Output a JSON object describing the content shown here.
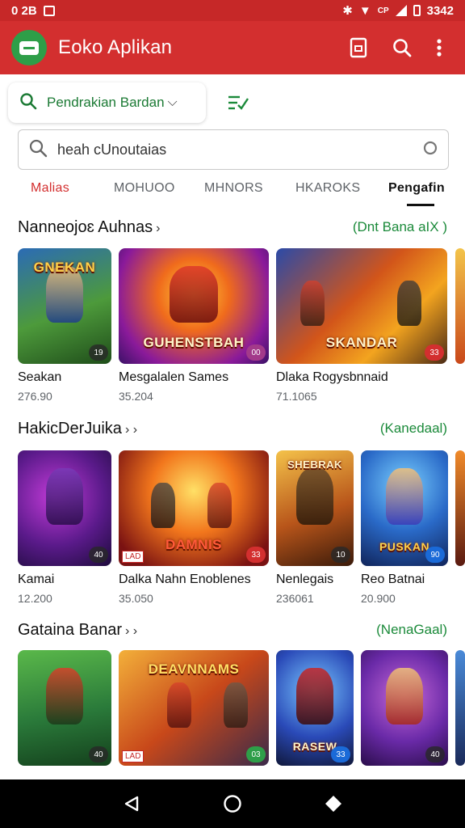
{
  "status_bar": {
    "time_left": "0 2B",
    "time_right": "3342",
    "signal_label": "CP"
  },
  "app_bar": {
    "title": "Eoko Aplikan",
    "accent_color": "#d32f2f",
    "icons": [
      "app-logo-icon",
      "bookmark-icon",
      "search-icon",
      "more-vert-icon"
    ]
  },
  "filter": {
    "label": "Pendrakian Bardan",
    "chevron": "⌵",
    "sort_icon": "sort-check-icon"
  },
  "search": {
    "value": "",
    "placeholder": "heah cUnoutaias"
  },
  "tabs": [
    {
      "label": "Malias",
      "state": "red"
    },
    {
      "label": "MOHUOO",
      "state": "normal"
    },
    {
      "label": "MHNORS",
      "state": "normal"
    },
    {
      "label": "HKAROKS",
      "state": "normal"
    },
    {
      "label": "Pengafin",
      "state": "active"
    }
  ],
  "sections": [
    {
      "title": "Nanneojoɛ Auhnas",
      "arrow": "›",
      "more": "(Dnt Bana aIX )",
      "cards": [
        {
          "name": "Seakan",
          "count": "276.90",
          "art_title": "GNEKAN",
          "badge": "19"
        },
        {
          "name": "Mesgalalen Sames",
          "count": "35.204",
          "art_title": "GUHENSTBAH",
          "badge": "00"
        },
        {
          "name": "Dlaka Rogysbnnaid",
          "count": "71.1065",
          "art_title": "SKANDAR",
          "badge": "33"
        }
      ]
    },
    {
      "title": "HakicDerJuika",
      "arrow": "› ›",
      "more": "(Kanedaal)",
      "cards": [
        {
          "name": "Kamai",
          "count": "12.200",
          "art_title": "",
          "badge": "40"
        },
        {
          "name": "Dalka Nahn Enoblenes",
          "count": "35.050",
          "art_title": "DAMNIS",
          "badge": "33",
          "tag": "LAD"
        },
        {
          "name": "Nenlegais",
          "count": "236061",
          "art_title": "SHEBRAK",
          "badge": "10"
        },
        {
          "name": "Reo Batnai",
          "count": "20.900",
          "art_title": "PUSKAN",
          "badge": "90"
        }
      ]
    },
    {
      "title": "Gataina Banar",
      "arrow": "› ›",
      "more": "(NenaGaal)",
      "cards": [
        {
          "name": "",
          "count": "",
          "art_title": "",
          "badge": "40"
        },
        {
          "name": "",
          "count": "",
          "art_title": "DEAVNNAMS",
          "badge": "03",
          "tag": "LAD"
        },
        {
          "name": "",
          "count": "",
          "art_title": "RASEW",
          "badge": "33"
        },
        {
          "name": "",
          "count": "",
          "art_title": "",
          "badge": "40"
        }
      ]
    }
  ],
  "nav_bar": {
    "icons": [
      "back-icon",
      "home-icon",
      "recents-icon"
    ]
  }
}
